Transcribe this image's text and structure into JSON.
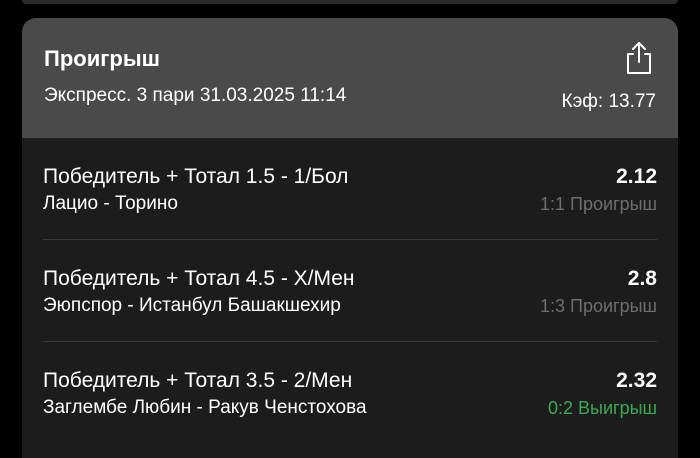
{
  "bet": {
    "status": "Проигрыш",
    "subtitle": "Экспресс. 3 пари 31.03.2025 11:14",
    "coef_label": "Кэф: 13.77",
    "share_icon": "share-icon"
  },
  "legs": [
    {
      "market": "Победитель + Тотал 1.5 - 1/Бол",
      "match": "Лацио - Торино",
      "odds": "2.12",
      "result": "1:1 Проигрыш",
      "result_color": "#6e6e6e"
    },
    {
      "market": "Победитель + Тотал 4.5 - Х/Мен",
      "match": "Эюпспор - Истанбул Башакшехир",
      "odds": "2.8",
      "result": "1:3 Проигрыш",
      "result_color": "#6e6e6e"
    },
    {
      "market": "Победитель + Тотал 3.5 - 2/Мен",
      "match": "Заглембе Любин - Ракув Ченстохова",
      "odds": "2.32",
      "result": "0:2 Выигрыш",
      "result_color": "#3aaa4e"
    }
  ],
  "colors": {
    "header_bg": "#4a4a4a",
    "card_bg": "#1c1c1c",
    "loss": "#6e6e6e",
    "win": "#3aaa4e"
  }
}
